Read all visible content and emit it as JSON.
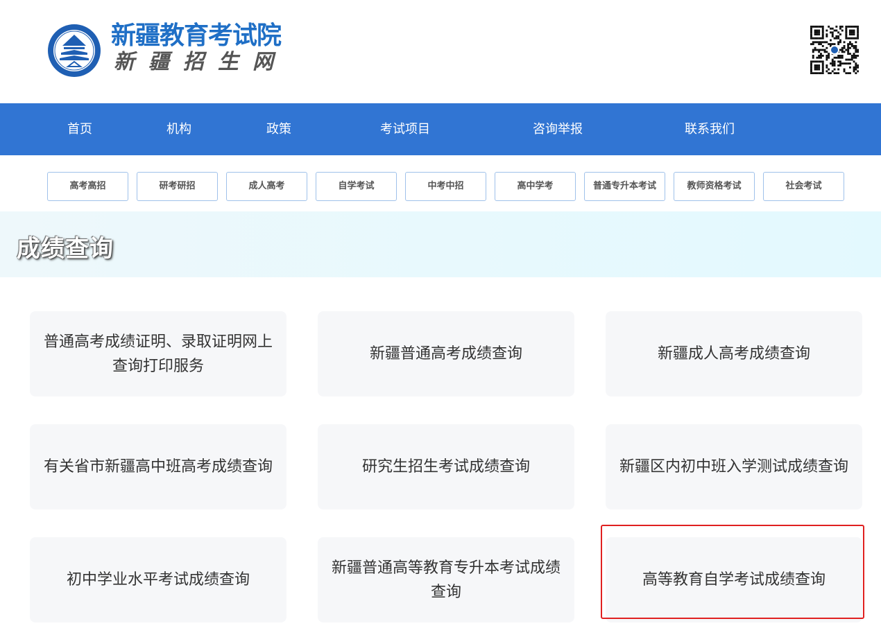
{
  "header": {
    "title": "新疆教育考试院",
    "subtitle": "新疆招生网",
    "seal_text": "新疆教育考试",
    "qr_icon": "qr-code-icon"
  },
  "colors": {
    "brand_blue": "#1f6fc6",
    "nav_blue": "#3175d3",
    "highlight_red": "#e02020",
    "card_bg": "#f6f7f9"
  },
  "nav": {
    "items": [
      {
        "label": "首页"
      },
      {
        "label": "机构"
      },
      {
        "label": "政策"
      },
      {
        "label": "考试项目"
      },
      {
        "label": "咨询举报"
      },
      {
        "label": "联系我们"
      }
    ]
  },
  "subtabs": [
    {
      "label": "高考高招"
    },
    {
      "label": "研考研招"
    },
    {
      "label": "成人高考"
    },
    {
      "label": "自学考试"
    },
    {
      "label": "中考中招"
    },
    {
      "label": "高中学考"
    },
    {
      "label": "普通专升本考试"
    },
    {
      "label": "教师资格考试"
    },
    {
      "label": "社会考试"
    }
  ],
  "banner": {
    "title": "成绩查询"
  },
  "cards": [
    {
      "label": "普通高考成绩证明、录取证明网上查询打印服务"
    },
    {
      "label": "新疆普通高考成绩查询"
    },
    {
      "label": "新疆成人高考成绩查询"
    },
    {
      "label": "有关省市新疆高中班高考成绩查询"
    },
    {
      "label": "研究生招生考试成绩查询"
    },
    {
      "label": "新疆区内初中班入学测试成绩查询"
    },
    {
      "label": "初中学业水平考试成绩查询"
    },
    {
      "label": "新疆普通高等教育专升本考试成绩查询"
    },
    {
      "label": "高等教育自学考试成绩查询",
      "highlighted": true
    }
  ]
}
